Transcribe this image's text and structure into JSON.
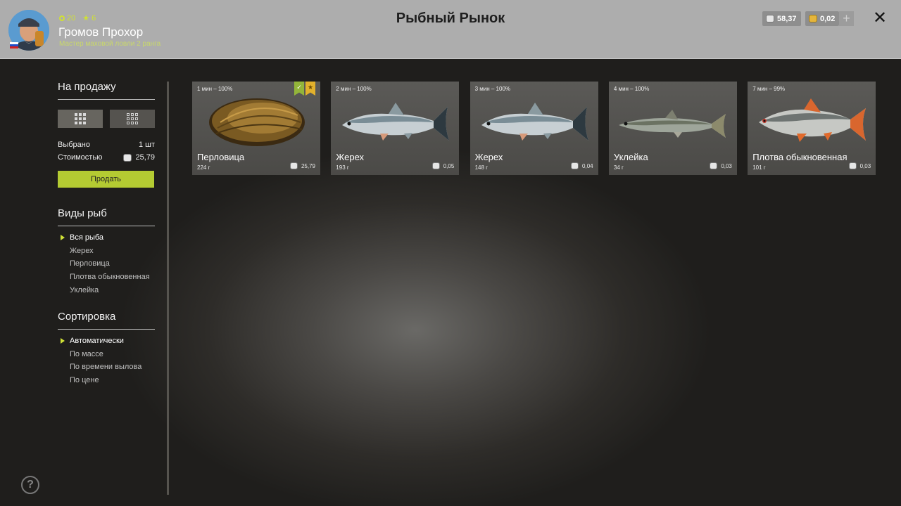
{
  "header": {
    "title": "Рыбный Рынок",
    "player": {
      "name": "Громов Прохор",
      "rank": "Мастер маховой ловли 2 ранга",
      "level": "20",
      "stars": "6"
    },
    "balance_silver": "58,37",
    "balance_gold": "0,02",
    "add_symbol": "+",
    "close_symbol": "✕"
  },
  "sale": {
    "title": "На продажу",
    "selected_label": "Выбрано",
    "selected_value": "1 шт",
    "cost_label": "Стоимостью",
    "cost_value": "25,79",
    "sell_button": "Продать"
  },
  "species": {
    "title": "Виды рыб",
    "items": [
      "Вся рыба",
      "Жерех",
      "Перловица",
      "Плотва обыкновенная",
      "Уклейка"
    ],
    "selected": "Вся рыба"
  },
  "sorting": {
    "title": "Сортировка",
    "items": [
      "Автоматически",
      "По массе",
      "По времени вылова",
      "По цене"
    ],
    "selected": "Автоматически"
  },
  "cards": [
    {
      "time": "1 мин – 100%",
      "name": "Перловица",
      "weight": "224 г",
      "price": "25,79",
      "icon": "mussel",
      "selected": true,
      "favorite": true
    },
    {
      "time": "2 мин – 100%",
      "name": "Жерех",
      "weight": "193 г",
      "price": "0,05",
      "icon": "asp-fish"
    },
    {
      "time": "3 мин – 100%",
      "name": "Жерех",
      "weight": "148 г",
      "price": "0,04",
      "icon": "asp-fish"
    },
    {
      "time": "4 мин – 100%",
      "name": "Уклейка",
      "weight": "34 г",
      "price": "0,03",
      "icon": "bleak-fish"
    },
    {
      "time": "7 мин – 99%",
      "name": "Плотва обыкновенная",
      "weight": "101 г",
      "price": "0,03",
      "icon": "roach-fish"
    }
  ],
  "help_symbol": "?",
  "colors": {
    "accent": "#b4cb32",
    "header_bg": "#adadad"
  }
}
